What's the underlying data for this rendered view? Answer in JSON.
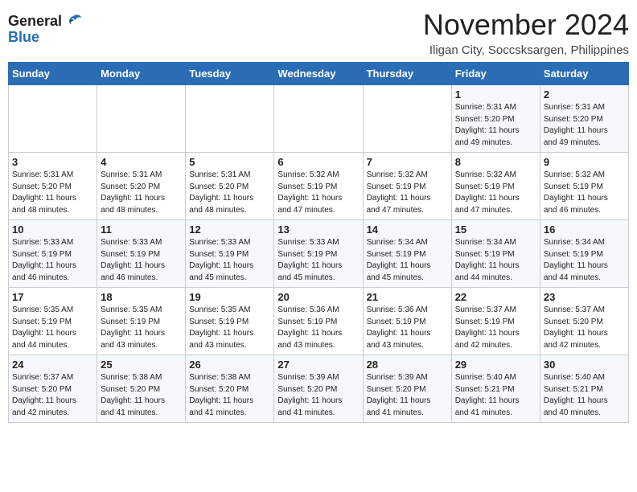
{
  "header": {
    "logo_general": "General",
    "logo_blue": "Blue",
    "month_title": "November 2024",
    "location": "Iligan City, Soccsksargen, Philippines"
  },
  "weekdays": [
    "Sunday",
    "Monday",
    "Tuesday",
    "Wednesday",
    "Thursday",
    "Friday",
    "Saturday"
  ],
  "weeks": [
    [
      {
        "day": "",
        "info": ""
      },
      {
        "day": "",
        "info": ""
      },
      {
        "day": "",
        "info": ""
      },
      {
        "day": "",
        "info": ""
      },
      {
        "day": "",
        "info": ""
      },
      {
        "day": "1",
        "info": "Sunrise: 5:31 AM\nSunset: 5:20 PM\nDaylight: 11 hours\nand 49 minutes."
      },
      {
        "day": "2",
        "info": "Sunrise: 5:31 AM\nSunset: 5:20 PM\nDaylight: 11 hours\nand 49 minutes."
      }
    ],
    [
      {
        "day": "3",
        "info": "Sunrise: 5:31 AM\nSunset: 5:20 PM\nDaylight: 11 hours\nand 48 minutes."
      },
      {
        "day": "4",
        "info": "Sunrise: 5:31 AM\nSunset: 5:20 PM\nDaylight: 11 hours\nand 48 minutes."
      },
      {
        "day": "5",
        "info": "Sunrise: 5:31 AM\nSunset: 5:20 PM\nDaylight: 11 hours\nand 48 minutes."
      },
      {
        "day": "6",
        "info": "Sunrise: 5:32 AM\nSunset: 5:19 PM\nDaylight: 11 hours\nand 47 minutes."
      },
      {
        "day": "7",
        "info": "Sunrise: 5:32 AM\nSunset: 5:19 PM\nDaylight: 11 hours\nand 47 minutes."
      },
      {
        "day": "8",
        "info": "Sunrise: 5:32 AM\nSunset: 5:19 PM\nDaylight: 11 hours\nand 47 minutes."
      },
      {
        "day": "9",
        "info": "Sunrise: 5:32 AM\nSunset: 5:19 PM\nDaylight: 11 hours\nand 46 minutes."
      }
    ],
    [
      {
        "day": "10",
        "info": "Sunrise: 5:33 AM\nSunset: 5:19 PM\nDaylight: 11 hours\nand 46 minutes."
      },
      {
        "day": "11",
        "info": "Sunrise: 5:33 AM\nSunset: 5:19 PM\nDaylight: 11 hours\nand 46 minutes."
      },
      {
        "day": "12",
        "info": "Sunrise: 5:33 AM\nSunset: 5:19 PM\nDaylight: 11 hours\nand 45 minutes."
      },
      {
        "day": "13",
        "info": "Sunrise: 5:33 AM\nSunset: 5:19 PM\nDaylight: 11 hours\nand 45 minutes."
      },
      {
        "day": "14",
        "info": "Sunrise: 5:34 AM\nSunset: 5:19 PM\nDaylight: 11 hours\nand 45 minutes."
      },
      {
        "day": "15",
        "info": "Sunrise: 5:34 AM\nSunset: 5:19 PM\nDaylight: 11 hours\nand 44 minutes."
      },
      {
        "day": "16",
        "info": "Sunrise: 5:34 AM\nSunset: 5:19 PM\nDaylight: 11 hours\nand 44 minutes."
      }
    ],
    [
      {
        "day": "17",
        "info": "Sunrise: 5:35 AM\nSunset: 5:19 PM\nDaylight: 11 hours\nand 44 minutes."
      },
      {
        "day": "18",
        "info": "Sunrise: 5:35 AM\nSunset: 5:19 PM\nDaylight: 11 hours\nand 43 minutes."
      },
      {
        "day": "19",
        "info": "Sunrise: 5:35 AM\nSunset: 5:19 PM\nDaylight: 11 hours\nand 43 minutes."
      },
      {
        "day": "20",
        "info": "Sunrise: 5:36 AM\nSunset: 5:19 PM\nDaylight: 11 hours\nand 43 minutes."
      },
      {
        "day": "21",
        "info": "Sunrise: 5:36 AM\nSunset: 5:19 PM\nDaylight: 11 hours\nand 43 minutes."
      },
      {
        "day": "22",
        "info": "Sunrise: 5:37 AM\nSunset: 5:19 PM\nDaylight: 11 hours\nand 42 minutes."
      },
      {
        "day": "23",
        "info": "Sunrise: 5:37 AM\nSunset: 5:20 PM\nDaylight: 11 hours\nand 42 minutes."
      }
    ],
    [
      {
        "day": "24",
        "info": "Sunrise: 5:37 AM\nSunset: 5:20 PM\nDaylight: 11 hours\nand 42 minutes."
      },
      {
        "day": "25",
        "info": "Sunrise: 5:38 AM\nSunset: 5:20 PM\nDaylight: 11 hours\nand 41 minutes."
      },
      {
        "day": "26",
        "info": "Sunrise: 5:38 AM\nSunset: 5:20 PM\nDaylight: 11 hours\nand 41 minutes."
      },
      {
        "day": "27",
        "info": "Sunrise: 5:39 AM\nSunset: 5:20 PM\nDaylight: 11 hours\nand 41 minutes."
      },
      {
        "day": "28",
        "info": "Sunrise: 5:39 AM\nSunset: 5:20 PM\nDaylight: 11 hours\nand 41 minutes."
      },
      {
        "day": "29",
        "info": "Sunrise: 5:40 AM\nSunset: 5:21 PM\nDaylight: 11 hours\nand 41 minutes."
      },
      {
        "day": "30",
        "info": "Sunrise: 5:40 AM\nSunset: 5:21 PM\nDaylight: 11 hours\nand 40 minutes."
      }
    ]
  ]
}
